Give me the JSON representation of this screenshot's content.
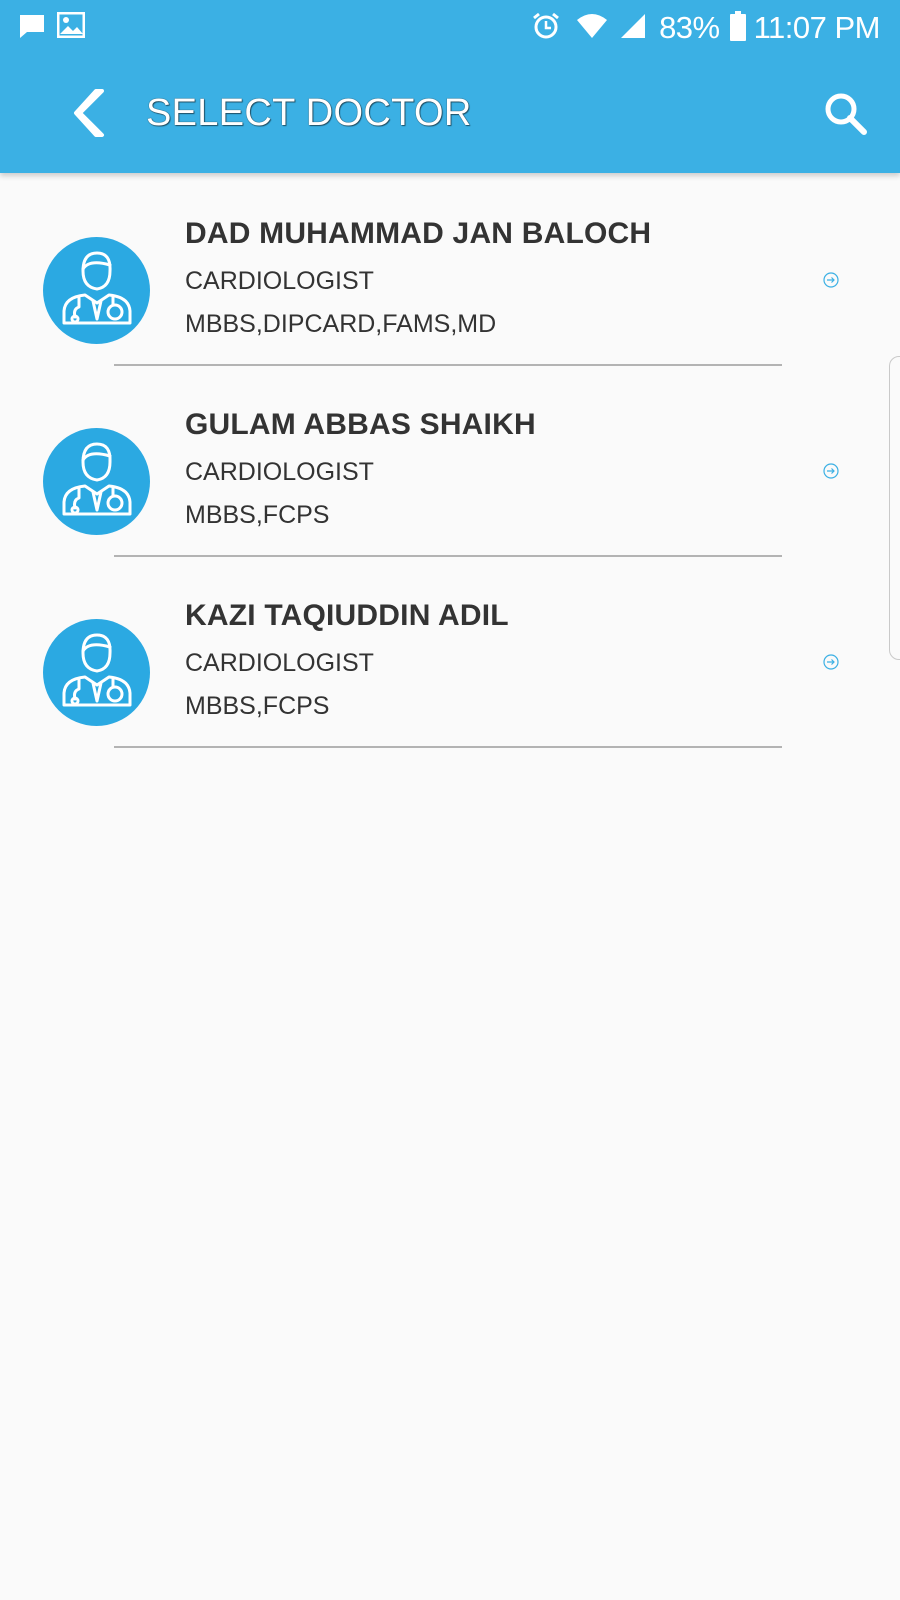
{
  "status_bar": {
    "battery": "83%",
    "time": "11:07 PM",
    "icons": [
      "message-icon",
      "image-icon",
      "alarm-icon",
      "wifi-icon",
      "signal-icon",
      "battery-icon"
    ]
  },
  "toolbar": {
    "title": "SELECT DOCTOR",
    "back_icon": "chevron-left-icon",
    "search_icon": "search-icon",
    "background": "#3bb0e4"
  },
  "doctors": [
    {
      "name": "DAD MUHAMMAD JAN BALOCH",
      "specialty": "CARDIOLOGIST",
      "qualifications": "MBBS,DIPCARD,FAMS,MD"
    },
    {
      "name": "GULAM ABBAS SHAIKH",
      "specialty": "CARDIOLOGIST",
      "qualifications": "MBBS,FCPS"
    },
    {
      "name": "KAZI TAQIUDDIN ADIL",
      "specialty": "CARDIOLOGIST",
      "qualifications": "MBBS,FCPS"
    }
  ],
  "colors": {
    "accent": "#3bb0e4",
    "avatar": "#2ba9e2",
    "text": "#333333",
    "divider": "#b3b3b3"
  }
}
